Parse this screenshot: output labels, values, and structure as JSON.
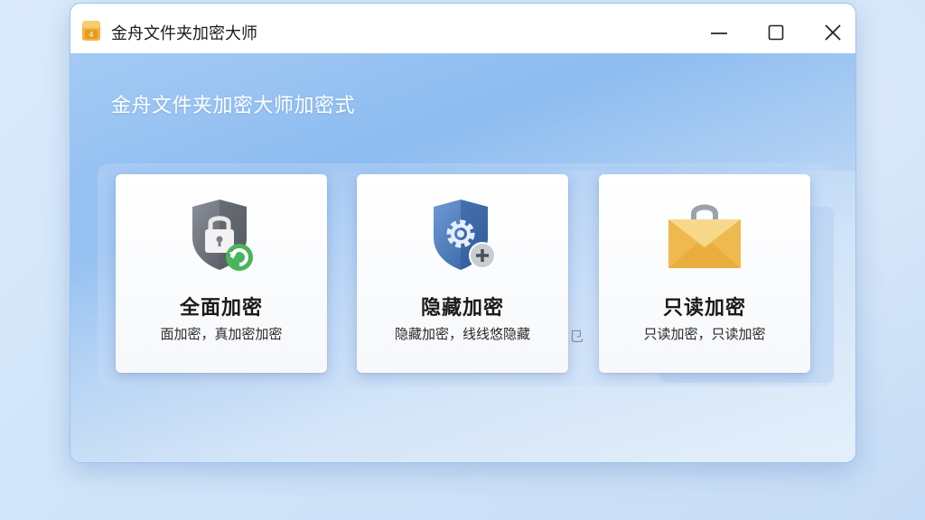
{
  "window": {
    "title": "金舟文件夹加密大师",
    "app_icon": "folder-lock-app-icon",
    "controls": [
      "minimize-icon",
      "maximize-icon",
      "close-icon"
    ]
  },
  "main": {
    "heading": "金舟文件夹加密大师加密式",
    "background_glyph": "㔾",
    "cards": [
      {
        "title": "全面加密",
        "description": "面加密，真加密加密",
        "icon": "shield-lock-icon"
      },
      {
        "title": "隐藏加密",
        "description": "隐藏加密，线线悠隐藏",
        "icon": "shield-gear-icon"
      },
      {
        "title": "只读加密",
        "description": "只读加密，只读加密",
        "icon": "envelope-bag-icon"
      }
    ]
  },
  "colors": {
    "window_gradient_top": "#a9cdf5",
    "window_gradient_mid": "#8dbcf0",
    "titlebar": "#ffffff",
    "heading_text": "#ffffff",
    "card_bg": "#ffffff",
    "shield_gray": "#6b7079",
    "shield_blue": "#3f73b8",
    "refresh_green": "#49b45a",
    "envelope_yellow": "#f4c460"
  }
}
